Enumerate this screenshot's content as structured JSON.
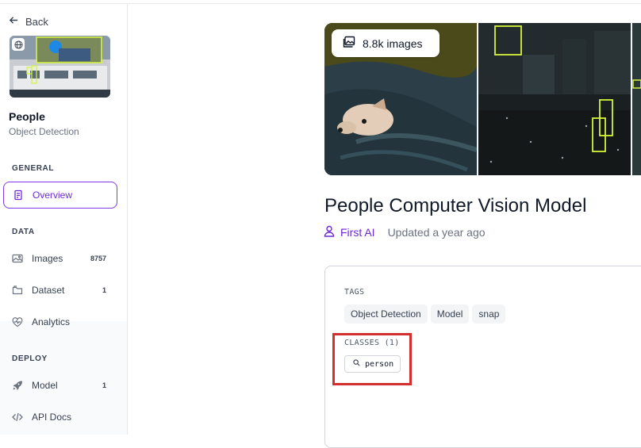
{
  "sidebar": {
    "back_label": "Back",
    "project_name": "People",
    "project_type": "Object Detection",
    "sections": {
      "general": "GENERAL",
      "data": "DATA",
      "deploy": "DEPLOY"
    },
    "items": [
      {
        "label": "Overview",
        "icon": "document-icon",
        "active": true
      },
      {
        "label": "Images",
        "icon": "image-icon",
        "count": "8757"
      },
      {
        "label": "Dataset",
        "icon": "folder-icon",
        "count": "1"
      },
      {
        "label": "Analytics",
        "icon": "heart-pulse-icon"
      },
      {
        "label": "Model",
        "icon": "rocket-icon",
        "count": "1"
      },
      {
        "label": "API Docs",
        "icon": "code-icon"
      }
    ]
  },
  "main": {
    "image_count": "8.8k images",
    "title": "People Computer Vision Model",
    "author": "First AI",
    "updated": "Updated a year ago",
    "tags_label": "TAGS",
    "tags": [
      "Object Detection",
      "Model",
      "snap"
    ],
    "classes_label": "CLASSES (1)",
    "classes": [
      "person"
    ]
  },
  "colors": {
    "accent": "#6d28d9",
    "highlight": "#d32f2f",
    "box": "#d4f53a"
  }
}
